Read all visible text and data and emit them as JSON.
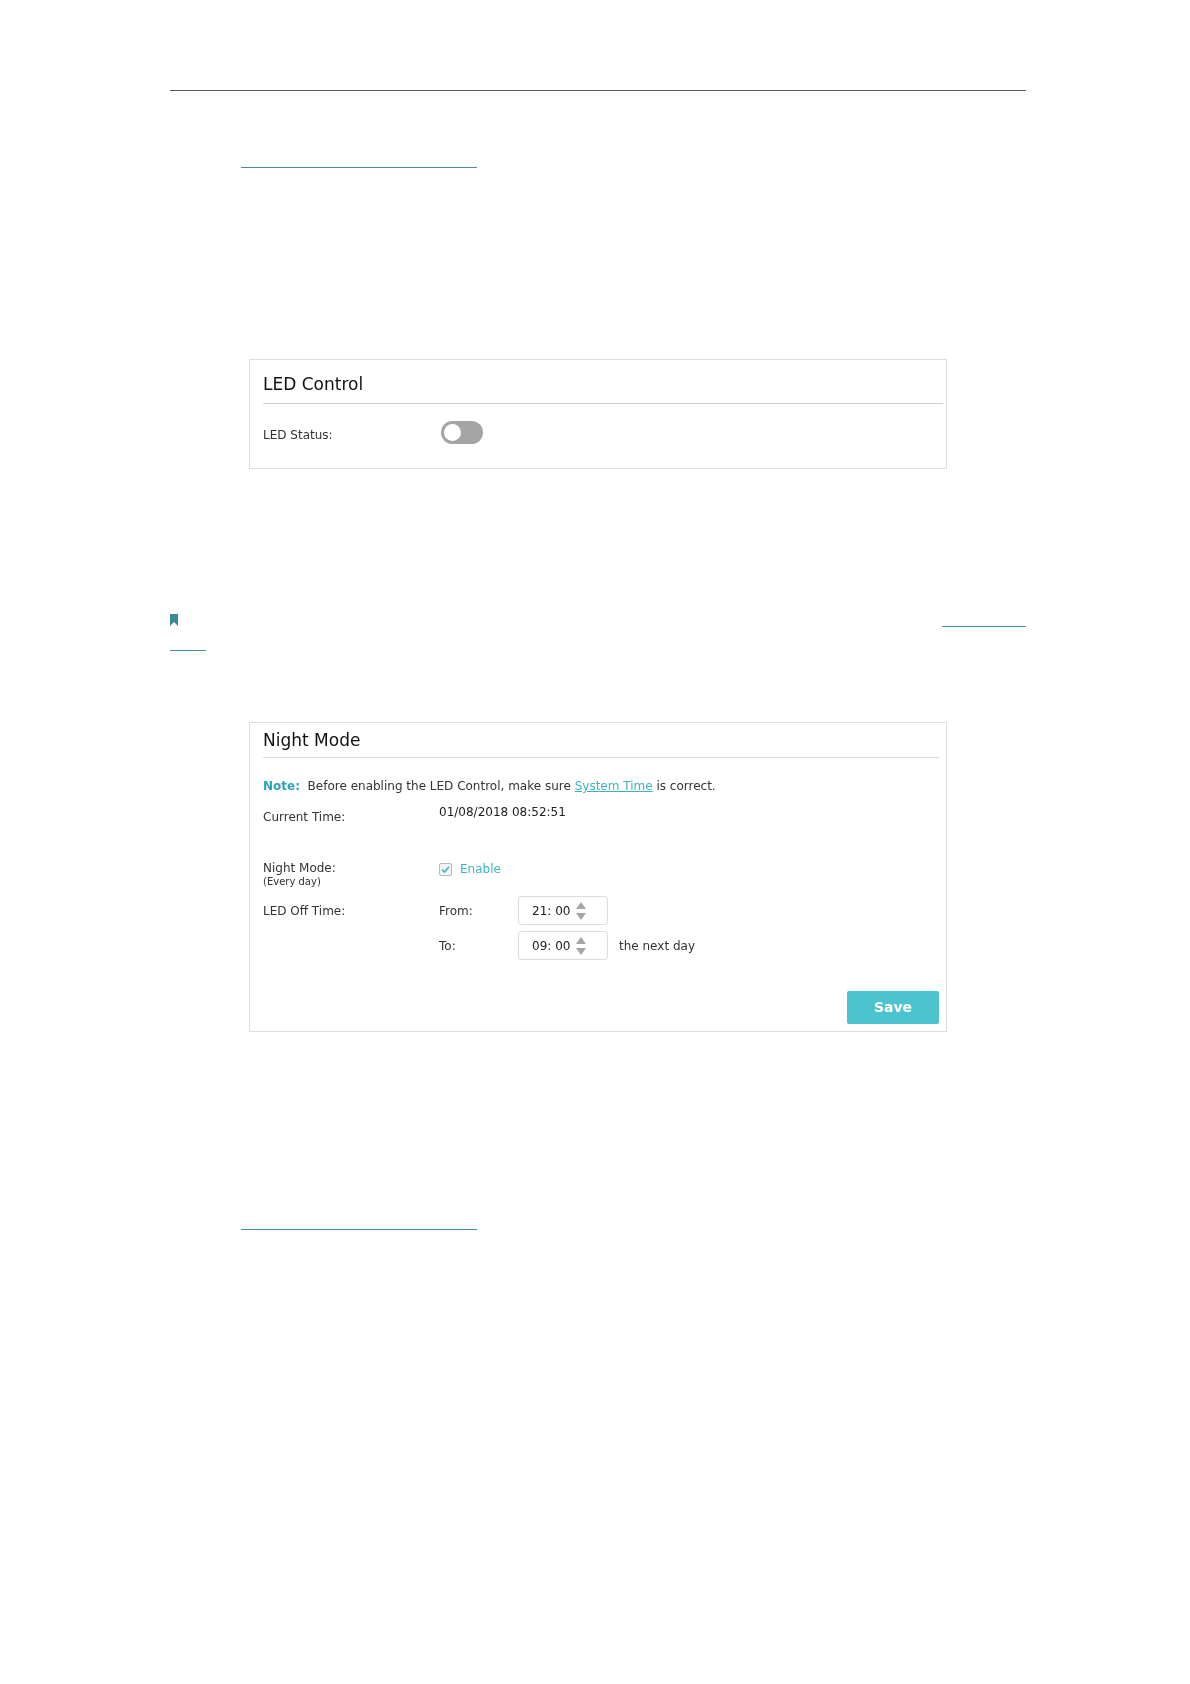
{
  "led_control": {
    "title": "LED Control",
    "led_status": {
      "label": "LED Status:",
      "on": false
    }
  },
  "night_mode": {
    "title": "Night Mode",
    "note": {
      "label": "Note:",
      "text_before": "Before enabling the LED Control, make sure",
      "link": "System Time",
      "text_after": "is correct."
    },
    "current_time": {
      "label": "Current Time:",
      "value": "01/08/2018 08:52:51"
    },
    "night_mode_setting": {
      "label": "Night Mode:",
      "sublabel": "(Every day)",
      "option": "Enable",
      "checked": true
    },
    "led_off_time": {
      "label": "LED Off Time:",
      "from": {
        "label": "From:",
        "value": "21: 00"
      },
      "to": {
        "label": "To:",
        "value": "09: 00",
        "suffix": "the next day"
      }
    },
    "save_button": "Save"
  }
}
